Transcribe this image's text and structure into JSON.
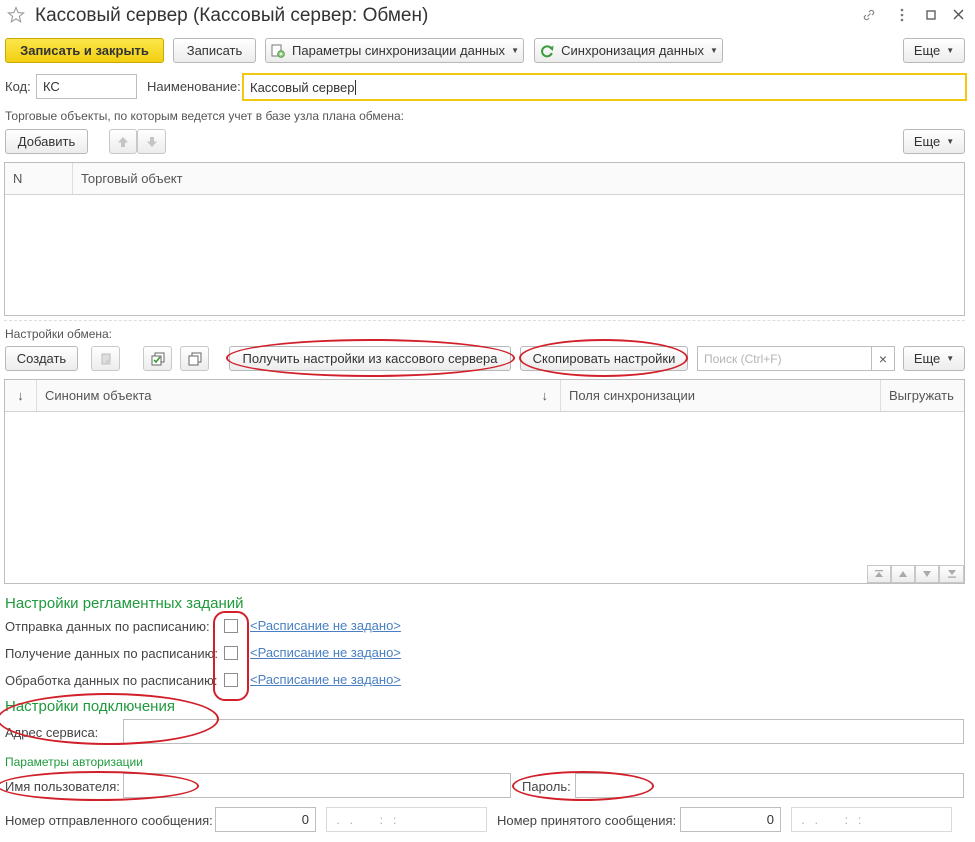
{
  "window": {
    "title": "Кассовый сервер (Кассовый сервер: Обмен)"
  },
  "toolbar": {
    "save_close": "Записать и закрыть",
    "save": "Записать",
    "sync_params": "Параметры синхронизации данных",
    "sync_data": "Синхронизация данных",
    "more": "Еще"
  },
  "form": {
    "code_label": "Код:",
    "code_value": "КС",
    "name_label": "Наименование:",
    "name_value": "Кассовый сервер"
  },
  "trade_objects": {
    "caption": "Торговые объекты, по которым ведется учет в базе узла плана обмена:",
    "add": "Добавить",
    "more": "Еще",
    "columns": [
      "N",
      "Торговый объект"
    ]
  },
  "exchange_settings": {
    "caption": "Настройки обмена:",
    "create": "Создать",
    "get_settings": "Получить настройки из кассового сервера",
    "copy_settings": "Скопировать настройки",
    "search_placeholder": "Поиск (Ctrl+F)",
    "search_clear": "×",
    "more": "Еще",
    "sort_glyph": "↓",
    "columns": [
      "Синоним объекта",
      "Поля синхронизации",
      "Выгружать"
    ]
  },
  "scheduled": {
    "title": "Настройки регламентных заданий",
    "rows": [
      {
        "label": "Отправка данных по расписанию:",
        "link": "<Расписание не задано>"
      },
      {
        "label": "Получение данных по расписанию:",
        "link": "<Расписание не задано>"
      },
      {
        "label": "Обработка данных по расписанию:",
        "link": "<Расписание не задано>"
      }
    ]
  },
  "connection": {
    "title": "Настройки подключения",
    "address_label": "Адрес сервиса:",
    "auth_title": "Параметры авторизации",
    "user_label": "Имя пользователя:",
    "password_label": "Пароль:",
    "sent_label": "Номер отправленного сообщения:",
    "sent_value": "0",
    "sent_date": " .   .        :   :",
    "received_label": "Номер принятого сообщения:",
    "received_value": "0",
    "received_date": " .   .        :   :"
  }
}
